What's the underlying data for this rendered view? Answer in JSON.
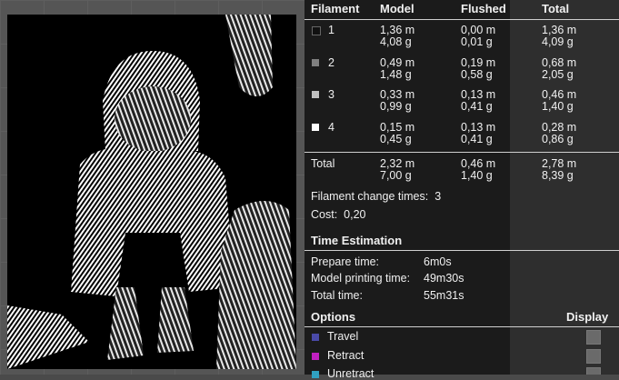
{
  "table": {
    "headers": [
      "Filament",
      "Model",
      "Flushed",
      "Total"
    ],
    "rows": [
      {
        "id": "1",
        "color": "#111111",
        "model": [
          "1,36 m",
          "4,08 g"
        ],
        "flushed": [
          "0,00 m",
          "0,01 g"
        ],
        "total": [
          "1,36 m",
          "4,09 g"
        ]
      },
      {
        "id": "2",
        "color": "#808080",
        "model": [
          "0,49 m",
          "1,48 g"
        ],
        "flushed": [
          "0,19 m",
          "0,58 g"
        ],
        "total": [
          "0,68 m",
          "2,05 g"
        ]
      },
      {
        "id": "3",
        "color": "#c0c0c0",
        "model": [
          "0,33 m",
          "0,99 g"
        ],
        "flushed": [
          "0,13 m",
          "0,41 g"
        ],
        "total": [
          "0,46 m",
          "1,40 g"
        ]
      },
      {
        "id": "4",
        "color": "#ffffff",
        "model": [
          "0,15 m",
          "0,45 g"
        ],
        "flushed": [
          "0,13 m",
          "0,41 g"
        ],
        "total": [
          "0,28 m",
          "0,86 g"
        ]
      }
    ],
    "summary": {
      "label": "Total",
      "model": [
        "2,32 m",
        "7,00 g"
      ],
      "flushed": [
        "0,46 m",
        "1,40 g"
      ],
      "total": [
        "2,78 m",
        "8,39 g"
      ]
    }
  },
  "filament_change": {
    "label": "Filament change times:",
    "value": "3"
  },
  "cost": {
    "label": "Cost:",
    "value": "0,20"
  },
  "time": {
    "title": "Time Estimation",
    "prepare": {
      "label": "Prepare time:",
      "value": "6m0s"
    },
    "model": {
      "label": "Model printing time:",
      "value": "49m30s"
    },
    "total": {
      "label": "Total time:",
      "value": "55m31s"
    }
  },
  "options": {
    "title": "Options",
    "display_label": "Display",
    "items": [
      {
        "label": "Travel",
        "color": "#4a4aa8"
      },
      {
        "label": "Retract",
        "color": "#c020c0"
      },
      {
        "label": "Unretract",
        "color": "#30a0c0"
      }
    ]
  }
}
